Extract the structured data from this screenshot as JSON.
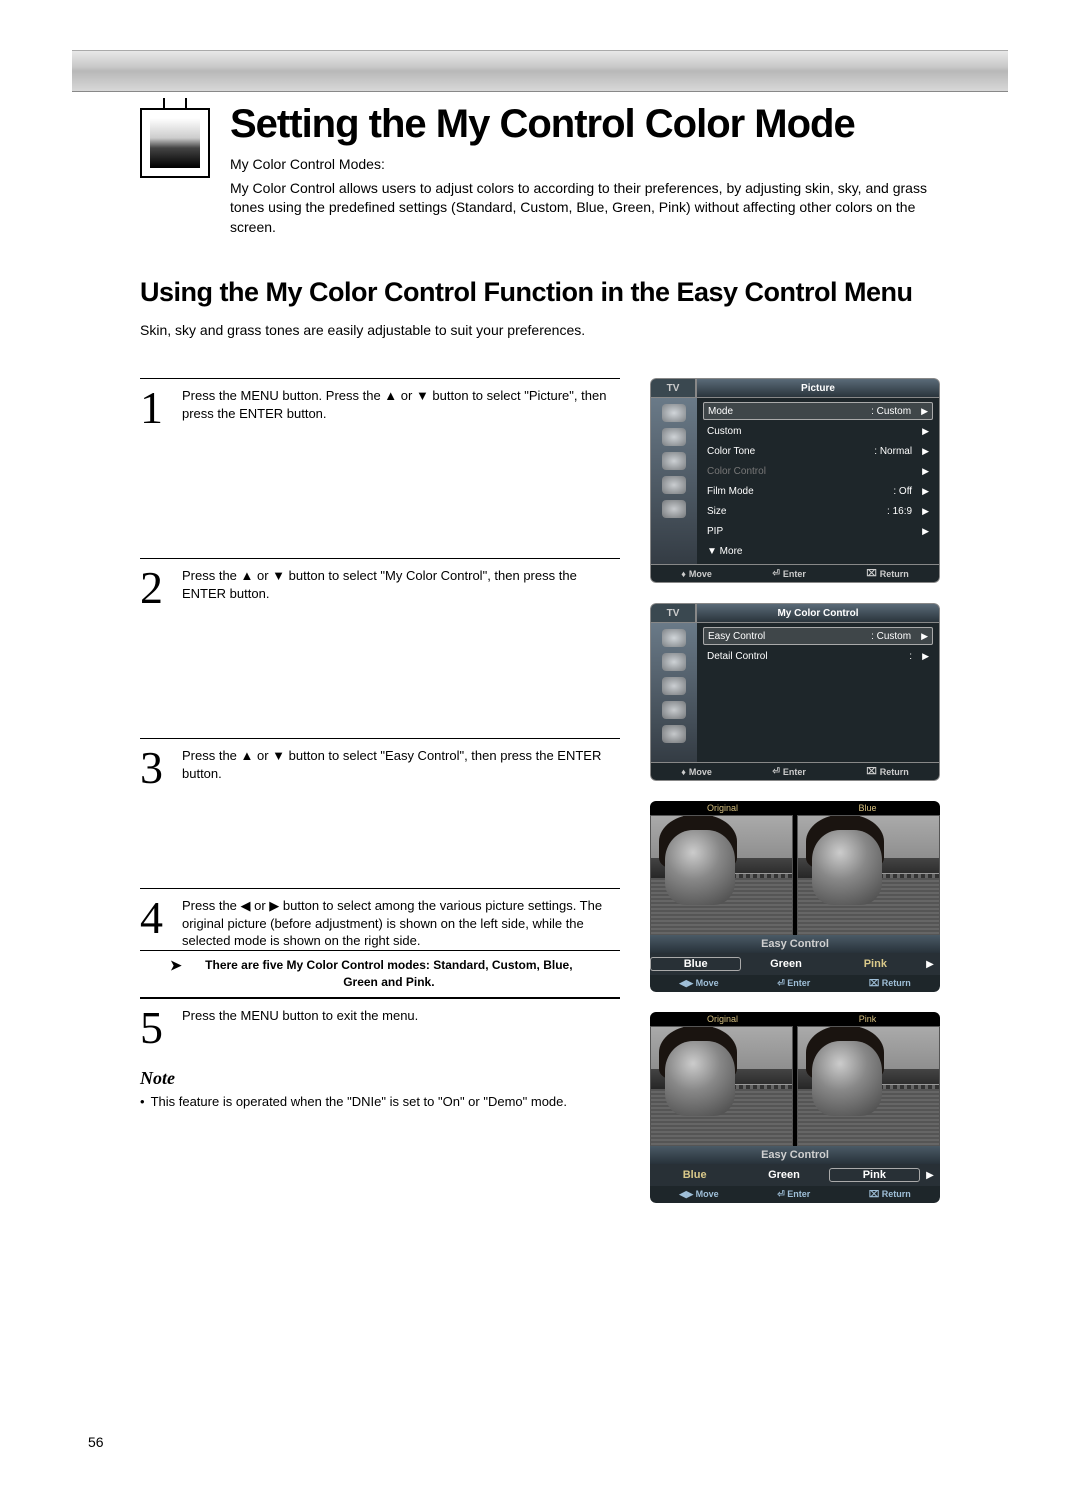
{
  "page_number": "56",
  "main_title": "Setting the My Control Color Mode",
  "intro_label": "My Color Control Modes:",
  "intro_text": "My Color Control allows users to adjust colors to according to their preferences, by adjusting skin, sky, and grass tones using the predefined settings (Standard, Custom, Blue, Green, Pink) without affecting other colors on the screen.",
  "section_title": "Using the My Color Control Function in the Easy Control Menu",
  "section_sub": "Skin, sky and grass tones are easily adjustable to suit your preferences.",
  "steps": [
    {
      "num": "1",
      "text": "Press the MENU button. Press the ▲ or ▼ button to select \"Picture\", then press the ENTER button."
    },
    {
      "num": "2",
      "text": "Press the ▲ or ▼ button to select \"My Color Control\", then press the ENTER button."
    },
    {
      "num": "3",
      "text": "Press the ▲ or ▼ button to select \"Easy Control\", then press the ENTER button."
    },
    {
      "num": "4",
      "text": "Press the ◀ or ▶ button to select among the various picture settings. The original picture (before adjustment) is shown on the left side, while the selected mode is shown on the right side."
    },
    {
      "num": "5",
      "text": "Press the MENU button to exit the menu."
    }
  ],
  "step_note": "There are five My Color Control modes: Standard, Custom, Blue, Green and Pink.",
  "note_heading": "Note",
  "note_body": "This feature is operated when the \"DNIe\" is set to \"On\" or \"Demo\" mode.",
  "osd1": {
    "tv": "TV",
    "title": "Picture",
    "rows": [
      {
        "lab": "Mode",
        "val": ": Custom",
        "sel": true
      },
      {
        "lab": "Custom",
        "val": ""
      },
      {
        "lab": "Color Tone",
        "val": ": Normal"
      },
      {
        "lab": "Color Control",
        "val": "",
        "dim": true
      },
      {
        "lab": "Film Mode",
        "val": ": Off"
      },
      {
        "lab": "Size",
        "val": ": 16:9"
      },
      {
        "lab": "PIP",
        "val": ""
      },
      {
        "lab": "▼ More",
        "val": "",
        "noarr": true
      }
    ],
    "footer": {
      "move": "Move",
      "enter": "Enter",
      "return": "Return"
    }
  },
  "osd2": {
    "tv": "TV",
    "title": "My Color Control",
    "rows": [
      {
        "lab": "Easy Control",
        "val": ": Custom",
        "sel": true
      },
      {
        "lab": "Detail Control",
        "val": ":"
      }
    ],
    "footer": {
      "move": "Move",
      "enter": "Enter",
      "return": "Return"
    }
  },
  "osd3": {
    "left_label": "Original",
    "right_label": "Blue",
    "ec_title": "Easy Control",
    "opts": [
      "Blue",
      "Green",
      "Pink"
    ],
    "selected": 0,
    "footer": {
      "move": "Move",
      "enter": "Enter",
      "return": "Return"
    }
  },
  "osd4": {
    "left_label": "Original",
    "right_label": "Pink",
    "ec_title": "Easy Control",
    "opts": [
      "Blue",
      "Green",
      "Pink"
    ],
    "selected": 2,
    "footer": {
      "move": "Move",
      "enter": "Enter",
      "return": "Return"
    }
  }
}
